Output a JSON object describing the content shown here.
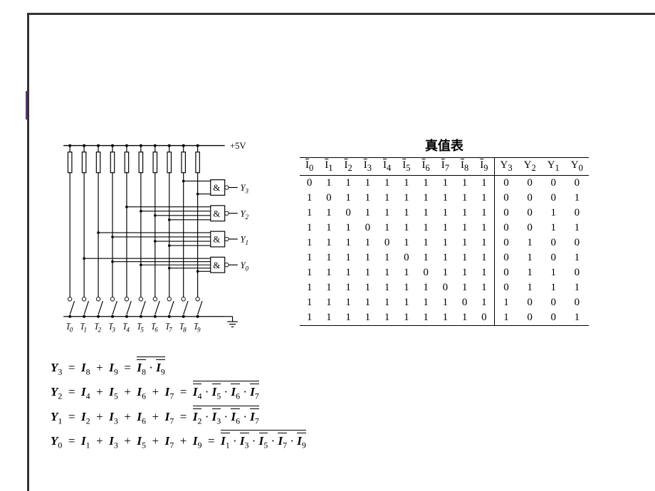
{
  "decoration": {
    "gold": "#d9a22b",
    "purple": "#5b3b7a",
    "grayblue": "#5a6a85",
    "border": "#333333"
  },
  "circuit": {
    "supply_label": "+5V",
    "inputs": [
      "I̅₀",
      "I̅₁",
      "I̅₂",
      "I̅₃",
      "I̅₄",
      "I̅₅",
      "I̅₆",
      "I̅₇",
      "I̅₈",
      "I̅₉"
    ],
    "outputs": [
      "Y₃",
      "Y₂",
      "Y₁",
      "Y₀"
    ],
    "gate_symbol": "&"
  },
  "truth_table": {
    "title": "真值表",
    "input_headers": [
      "I̅₀",
      "I̅₁",
      "I̅₂",
      "I̅₃",
      "I̅₄",
      "I̅₅",
      "I̅₆",
      "I̅₇",
      "I̅₈",
      "I̅₉"
    ],
    "output_headers": [
      "Y₃",
      "Y₂",
      "Y₁",
      "Y₀"
    ],
    "rows": [
      {
        "in": [
          0,
          1,
          1,
          1,
          1,
          1,
          1,
          1,
          1,
          1
        ],
        "out": [
          0,
          0,
          0,
          0
        ]
      },
      {
        "in": [
          1,
          0,
          1,
          1,
          1,
          1,
          1,
          1,
          1,
          1
        ],
        "out": [
          0,
          0,
          0,
          1
        ]
      },
      {
        "in": [
          1,
          1,
          0,
          1,
          1,
          1,
          1,
          1,
          1,
          1
        ],
        "out": [
          0,
          0,
          1,
          0
        ]
      },
      {
        "in": [
          1,
          1,
          1,
          0,
          1,
          1,
          1,
          1,
          1,
          1
        ],
        "out": [
          0,
          0,
          1,
          1
        ]
      },
      {
        "in": [
          1,
          1,
          1,
          1,
          0,
          1,
          1,
          1,
          1,
          1
        ],
        "out": [
          0,
          1,
          0,
          0
        ]
      },
      {
        "in": [
          1,
          1,
          1,
          1,
          1,
          0,
          1,
          1,
          1,
          1
        ],
        "out": [
          0,
          1,
          0,
          1
        ]
      },
      {
        "in": [
          1,
          1,
          1,
          1,
          1,
          1,
          0,
          1,
          1,
          1
        ],
        "out": [
          0,
          1,
          1,
          0
        ]
      },
      {
        "in": [
          1,
          1,
          1,
          1,
          1,
          1,
          1,
          0,
          1,
          1
        ],
        "out": [
          0,
          1,
          1,
          1
        ]
      },
      {
        "in": [
          1,
          1,
          1,
          1,
          1,
          1,
          1,
          1,
          0,
          1
        ],
        "out": [
          1,
          0,
          0,
          0
        ]
      },
      {
        "in": [
          1,
          1,
          1,
          1,
          1,
          1,
          1,
          1,
          1,
          0
        ],
        "out": [
          1,
          0,
          0,
          1
        ]
      }
    ]
  },
  "equations": [
    {
      "output": "Y₃",
      "or": [
        "I₈",
        "I₉"
      ],
      "nand": [
        "I̅₈",
        "I̅₉"
      ]
    },
    {
      "output": "Y₂",
      "or": [
        "I₄",
        "I₅",
        "I₆",
        "I₇"
      ],
      "nand": [
        "I̅₄",
        "I̅₅",
        "I̅₆",
        "I̅₇"
      ]
    },
    {
      "output": "Y₁",
      "or": [
        "I₂",
        "I₃",
        "I₆",
        "I₇"
      ],
      "nand": [
        "I̅₂",
        "I̅₃",
        "I̅₆",
        "I̅₇"
      ]
    },
    {
      "output": "Y₀",
      "or": [
        "I₁",
        "I₃",
        "I₅",
        "I₇",
        "I₉"
      ],
      "nand": [
        "I̅₁",
        "I̅₃",
        "I̅₅",
        "I̅₇",
        "I̅₉"
      ]
    }
  ]
}
